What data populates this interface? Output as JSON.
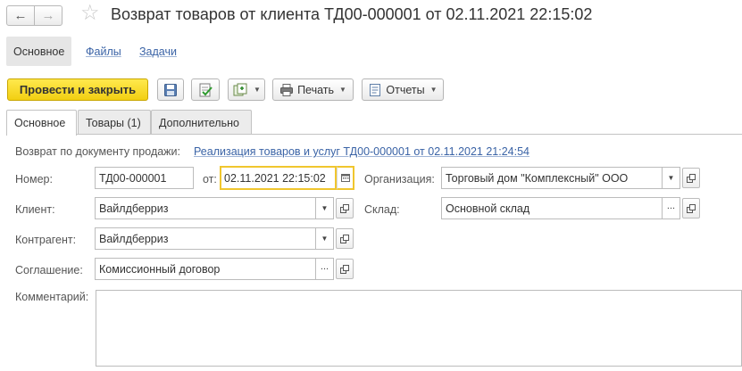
{
  "window": {
    "back_icon": "arrow-left-icon",
    "forward_icon": "arrow-right-icon",
    "favorite_icon": "star-icon",
    "title": "Возврат товаров от клиента ТД00-000001 от 02.11.2021 22:15:02"
  },
  "panel": {
    "items": [
      {
        "label": "Основное"
      },
      {
        "label": "Файлы"
      },
      {
        "label": "Задачи"
      }
    ]
  },
  "toolbar": {
    "post_close_label": "Провести и закрыть",
    "save_icon": "save-icon",
    "post_icon": "post-document-icon",
    "create_based_icon": "create-based-on-icon",
    "print_label": "Печать",
    "reports_label": "Отчеты"
  },
  "tabs": [
    {
      "label": "Основное"
    },
    {
      "label": "Товары (1)"
    },
    {
      "label": "Дополнительно"
    }
  ],
  "form": {
    "basis_label": "Возврат по документу продажи:",
    "basis_link": "Реализация товаров и услуг ТД00-000001 от 02.11.2021 21:24:54",
    "number_label": "Номер:",
    "number_value": "ТД00-000001",
    "date_label": "от:",
    "date_value": "02.11.2021 22:15:02",
    "organization_label": "Организация:",
    "organization_value": "Торговый дом \"Комплексный\" ООО",
    "client_label": "Клиент:",
    "client_value": "Вайлдберриз",
    "warehouse_label": "Склад:",
    "warehouse_value": "Основной склад",
    "counterparty_label": "Контрагент:",
    "counterparty_value": "Вайлдберриз",
    "agreement_label": "Соглашение:",
    "agreement_value": "Комиссионный договор",
    "comment_label": "Комментарий:",
    "comment_value": ""
  },
  "colors": {
    "primary_button": "#f2cf12",
    "link": "#3a63a6",
    "focus_border": "#f0c62e"
  }
}
